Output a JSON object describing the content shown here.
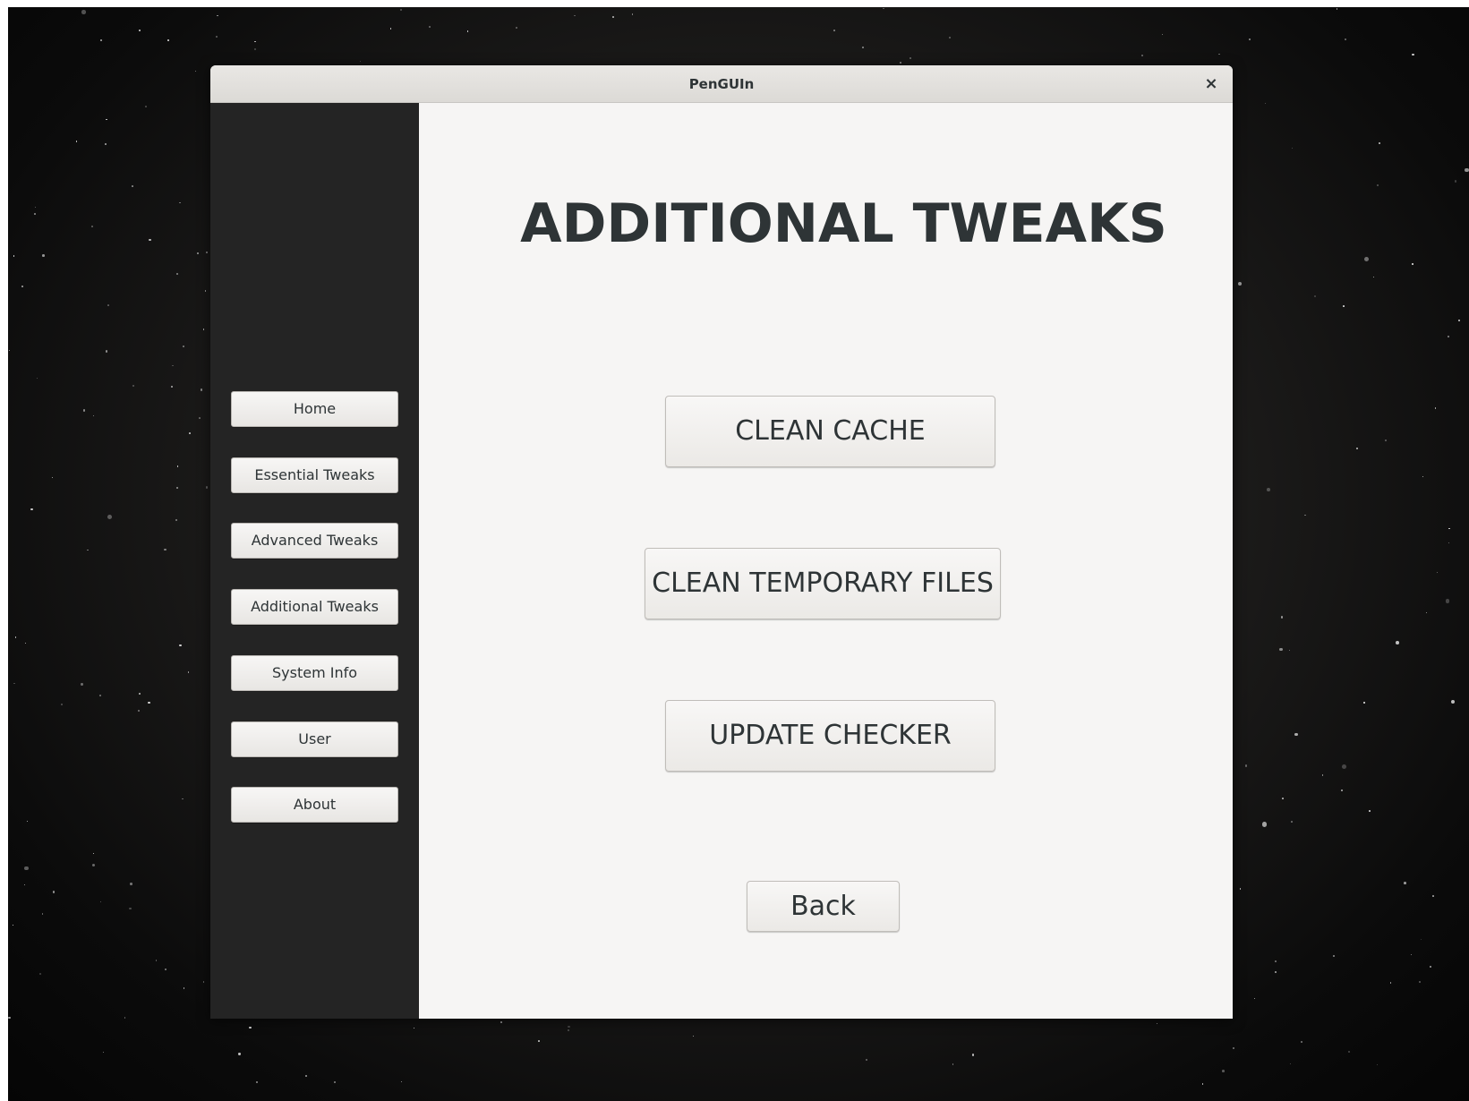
{
  "window": {
    "title": "PenGUIn",
    "close_glyph": "×",
    "close_icon": "close-icon"
  },
  "sidebar": {
    "items": [
      {
        "label": "Home"
      },
      {
        "label": "Essential Tweaks"
      },
      {
        "label": "Advanced Tweaks"
      },
      {
        "label": "Additional Tweaks"
      },
      {
        "label": "System Info"
      },
      {
        "label": "User"
      },
      {
        "label": "About"
      }
    ]
  },
  "main": {
    "title": "ADDITIONAL TWEAKS",
    "buttons": {
      "clean_cache": "CLEAN CACHE",
      "clean_temp": "CLEAN TEMPORARY FILES",
      "update_checker": "UPDATE CHECKER",
      "back": "Back"
    }
  },
  "colors": {
    "sidebar_bg": "#242424",
    "content_bg": "#f6f5f4",
    "text": "#2e3436"
  }
}
